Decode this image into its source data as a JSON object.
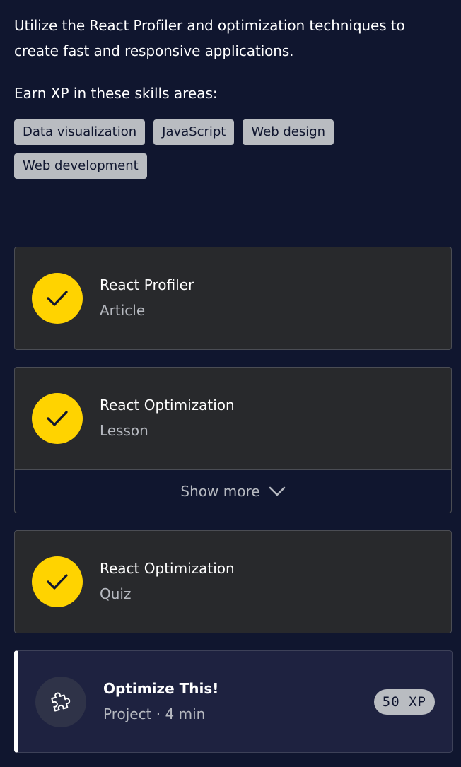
{
  "intro": {
    "description": "Utilize the React Profiler and optimization techniques to create fast and responsive applications.",
    "skills_heading": "Earn XP in these skills areas:",
    "skills": [
      "Data visualization",
      "JavaScript",
      "Web design",
      "Web development"
    ]
  },
  "items": [
    {
      "title": "React Profiler",
      "type": "Article",
      "icon": "check-icon",
      "completed": true
    },
    {
      "title": "React Optimization",
      "type": "Lesson",
      "icon": "check-icon",
      "completed": true,
      "show_more_label": "Show more"
    },
    {
      "title": "React Optimization",
      "type": "Quiz",
      "icon": "check-icon",
      "completed": true
    }
  ],
  "project": {
    "title": "Optimize This!",
    "meta": "Project · 4 min",
    "xp": "50 XP",
    "icon": "puzzle-icon"
  },
  "colors": {
    "background": "#10162f",
    "card": "#28292c",
    "check": "#ffd300",
    "tag": "#b9bcc1",
    "project_card": "#1e2240"
  }
}
